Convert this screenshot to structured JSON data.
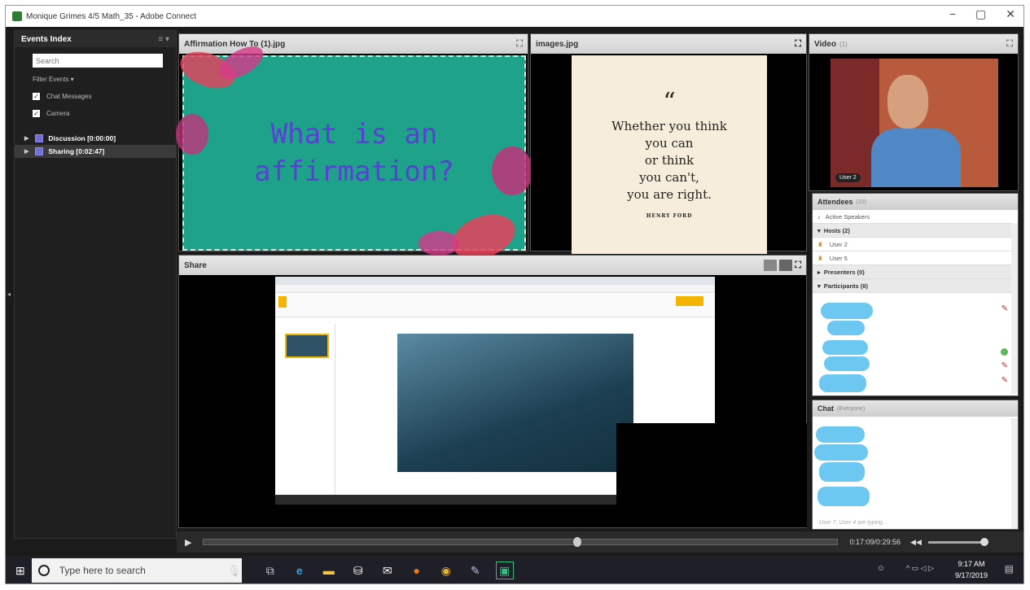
{
  "window": {
    "title": "Monique Grimes 4/5 Math_35 - Adobe Connect",
    "min": "−",
    "max": "▢",
    "close": "✕"
  },
  "events": {
    "title": "Events Index",
    "menu": "≡ ▾",
    "search_placeholder": "Search",
    "filter": "Filter Events ▾",
    "checks": [
      "Chat Messages",
      "Camera"
    ],
    "items": [
      "Discussion [0:00:00]",
      "Sharing [0:02:47]"
    ]
  },
  "pod_affirm": {
    "title": "Affirmation How To (1).jpg",
    "line1": "What is an",
    "line2": "affirmation?"
  },
  "pod_images": {
    "title": "images.jpg",
    "quote_mark": "“",
    "lines": [
      "Whether you think",
      "you can",
      "or think",
      "you can't,",
      "you are right."
    ],
    "author": "HENRY FORD"
  },
  "pod_video": {
    "title": "Video",
    "count": "(1)",
    "user_tag": "User 2"
  },
  "attendees": {
    "title": "Attendees",
    "count": "(10)",
    "active": "Active Speakers",
    "hosts": "Hosts (2)",
    "host_users": [
      "User 2",
      "User 5"
    ],
    "presenters": "Presenters (0)",
    "participants": "Participants (8)"
  },
  "chat": {
    "title": "Chat",
    "scope": "(Everyone)",
    "typing": "User 7, User 4 are typing..."
  },
  "share": {
    "title": "Share"
  },
  "playback": {
    "time": "0:17:09/0:29:56",
    "vol_icon": "◀◀"
  },
  "taskbar": {
    "search": "Type here to search",
    "time": "9:17 AM",
    "date": "9/17/2019"
  }
}
